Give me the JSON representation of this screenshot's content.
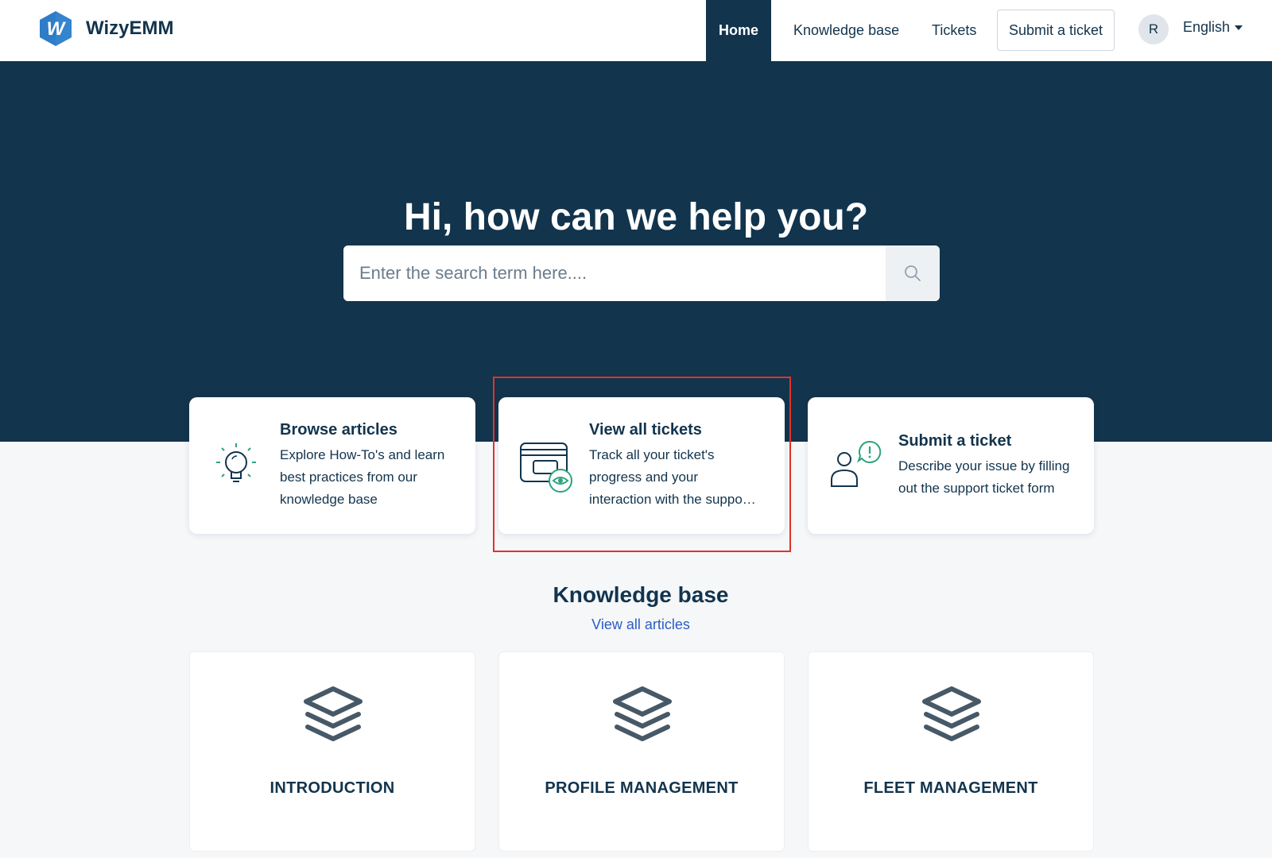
{
  "header": {
    "brand": "WizyEMM",
    "logo_letter": "W",
    "nav": {
      "home": "Home",
      "knowledge_base": "Knowledge base",
      "tickets": "Tickets",
      "submit_ticket": "Submit a ticket"
    },
    "avatar_initial": "R",
    "language": "English"
  },
  "hero": {
    "title": "Hi, how can we help you?",
    "search_placeholder": "Enter the search term here...."
  },
  "action_cards": [
    {
      "title": "Browse articles",
      "description": "Explore How-To's and learn best practices from our knowledge base",
      "icon": "lightbulb-icon"
    },
    {
      "title": "View all tickets",
      "description_line1": "Track all your ticket's",
      "description_line2": "progress and your",
      "description_line3": "interaction with the suppo…",
      "icon": "tickets-eye-icon"
    },
    {
      "title": "Submit a ticket",
      "description": "Describe your issue by filling out the support ticket form",
      "icon": "person-alert-icon"
    }
  ],
  "knowledge_base": {
    "title": "Knowledge base",
    "view_all": "View all articles",
    "categories": [
      {
        "label": "INTRODUCTION",
        "icon": "layers-icon"
      },
      {
        "label": "PROFILE MANAGEMENT",
        "icon": "layers-icon"
      },
      {
        "label": "FLEET MANAGEMENT",
        "icon": "layers-icon"
      }
    ]
  },
  "colors": {
    "primary": "#12344d",
    "accent_green": "#2ca47c",
    "link": "#2c5cc5",
    "highlight": "#e0332a",
    "logo_blue": "#2f7cc7"
  }
}
